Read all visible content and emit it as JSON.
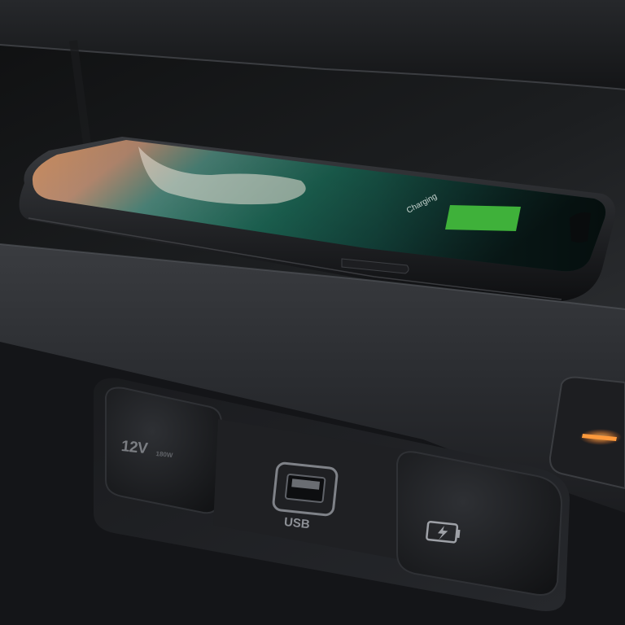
{
  "scene": {
    "description_labels": {
      "socket_12v": "12V",
      "socket_12v_sub": "180W",
      "usb_port": "USB"
    },
    "phone_screen": {
      "status_text": "Charging",
      "battery_color": "#3fb13a"
    },
    "indicator_color": "#ff9a3c"
  },
  "icons": [
    "usb-port-icon",
    "battery-charge-icon",
    "indicator-light-icon"
  ]
}
